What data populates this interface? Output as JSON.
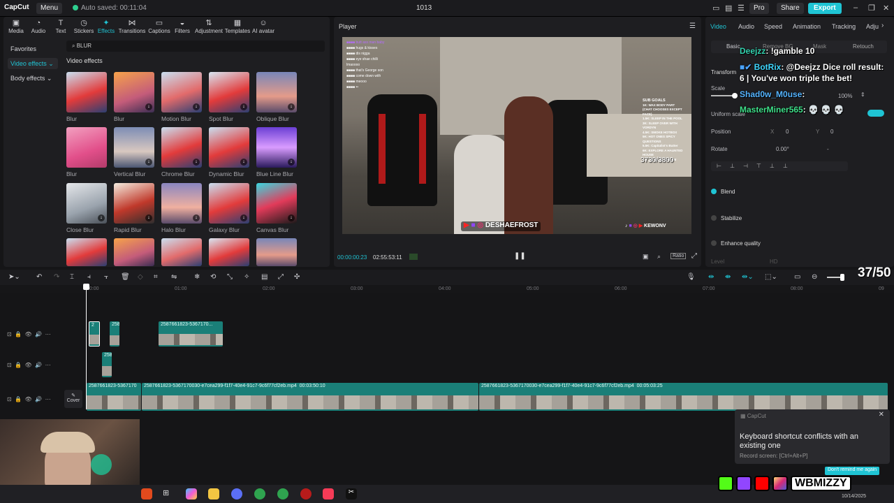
{
  "topbar": {
    "logo": "CapCut",
    "menu_label": "Menu",
    "autosave": "Auto saved: 00:11:04",
    "project_title": "1013",
    "pro_label": "Pro",
    "share_label": "Share",
    "export_label": "Export",
    "accent_color": "#1fc4d4"
  },
  "tools": [
    {
      "label": "Media",
      "icon": "media-icon"
    },
    {
      "label": "Audio",
      "icon": "audio-icon"
    },
    {
      "label": "Text",
      "icon": "text-icon"
    },
    {
      "label": "Stickers",
      "icon": "stickers-icon"
    },
    {
      "label": "Effects",
      "icon": "effects-icon"
    },
    {
      "label": "Transitions",
      "icon": "transitions-icon"
    },
    {
      "label": "Captions",
      "icon": "captions-icon"
    },
    {
      "label": "Filters",
      "icon": "filters-icon"
    },
    {
      "label": "Adjustment",
      "icon": "adjustment-icon"
    },
    {
      "label": "Templates",
      "icon": "templates-icon"
    },
    {
      "label": "AI avatar",
      "icon": "ai-avatar-icon"
    }
  ],
  "categories": {
    "favorites": "Favorites",
    "video_effects": "Video effects",
    "body_effects": "Body effects"
  },
  "search": {
    "value": "BLUR"
  },
  "effects_section": "Video effects",
  "effects": [
    {
      "label": "Blur"
    },
    {
      "label": "Blur"
    },
    {
      "label": "Motion Blur"
    },
    {
      "label": "Spot Blur"
    },
    {
      "label": "Oblique Blur"
    },
    {
      "label": "Blur"
    },
    {
      "label": "Vertical Blur"
    },
    {
      "label": "Chrome Blur"
    },
    {
      "label": "Dynamic Blur"
    },
    {
      "label": "Blue Line Blur"
    },
    {
      "label": "Close Blur"
    },
    {
      "label": "Rapid Blur"
    },
    {
      "label": "Halo Blur"
    },
    {
      "label": "Galaxy Blur"
    },
    {
      "label": "Canvas Blur"
    }
  ],
  "player": {
    "title": "Player",
    "current_time": "00:00:00:23",
    "total_time": "02:55:53:11",
    "ratio_label": "Ratio",
    "overlay_counter": "3730/3800",
    "overlay_handle": "DESHAEFROST",
    "overlay_right_handle": "KEWONV",
    "sub_goals_title": "SUB GOALS",
    "sub_goals": [
      "1K: WAX BODY PART",
      "(CHAT CHOOSES EXCEPT FACE)",
      "1.5K: SLEEP IN THE POOL",
      "3K: SLEEP OVER WITH VORDYN",
      "4.5K: SMOKE HOTBOX",
      "5K: HOT ONES SPICY QUESTIONS",
      "5.5K: Capitalist's Butter",
      "6K: EXPLORE A HAUNTED HOUSE",
      "7K: 24 HOUR STREAM"
    ]
  },
  "right_panel": {
    "tabs": [
      "Video",
      "Audio",
      "Speed",
      "Animation",
      "Tracking",
      "Adju"
    ],
    "subtabs": [
      "Basic",
      "Remove BG",
      "Mask",
      "Retouch"
    ],
    "transform": "Transform",
    "scale": "Scale",
    "scale_value": "100%",
    "uniform_scale": "Uniform scale",
    "position": "Position",
    "pos_x_label": "X",
    "pos_x": "0",
    "pos_y_label": "Y",
    "pos_y": "0",
    "rotate": "Rotate",
    "rotate_value": "0.00°",
    "rotate_dash": "-",
    "blend": "Blend",
    "stabilize": "Stabilize",
    "enhance_quality": "Enhance quality",
    "level": "Level",
    "level_value": "HD"
  },
  "chat": [
    {
      "user": "Deejzz",
      "text": ": !gamble 10"
    },
    {
      "user": "BotRix",
      "text": ": @Deejzz Dice roll result: 6 | You've won triple the bet!"
    },
    {
      "user": "Shad0w_M0use",
      "text": ":"
    },
    {
      "user": "MasterMiner565",
      "text": ": 💀 💀 💀"
    }
  ],
  "timeline": {
    "ruler": [
      "00:00",
      "01:00",
      "02:00",
      "03:00",
      "04:00",
      "05:00",
      "06:00",
      "07:00",
      "08:00",
      "09"
    ],
    "counter": "37/50",
    "clip_a": "2587661823-5367170...",
    "clip_small_1": "2",
    "clip_small_2": "258",
    "clip_small_3": "258",
    "main_clip_1": "2587661823-5367170",
    "main_clip_2": "2587661823-5367170030-e7cea299-f1f7-40e4-91c7-9c6f77cf2eb.mp4",
    "main_clip_2_duration": "00:03:50:10",
    "main_clip_3": "2587661823-5367170030-e7cea299-f1f7-40e4-91c7-9c6f77cf2eb.mp4",
    "main_clip_3_duration": "00:05:03:25",
    "cover": "Cover"
  },
  "toast": {
    "app": "CapCut",
    "title": "Keyboard shortcut conflicts with an existing one",
    "detail": "Record screen: [Ctrl+Alt+P]",
    "button": "Don't remind me again"
  },
  "socials": {
    "handle": "WBMIZZY"
  },
  "taskbar": {
    "date": "10/14/2025"
  }
}
